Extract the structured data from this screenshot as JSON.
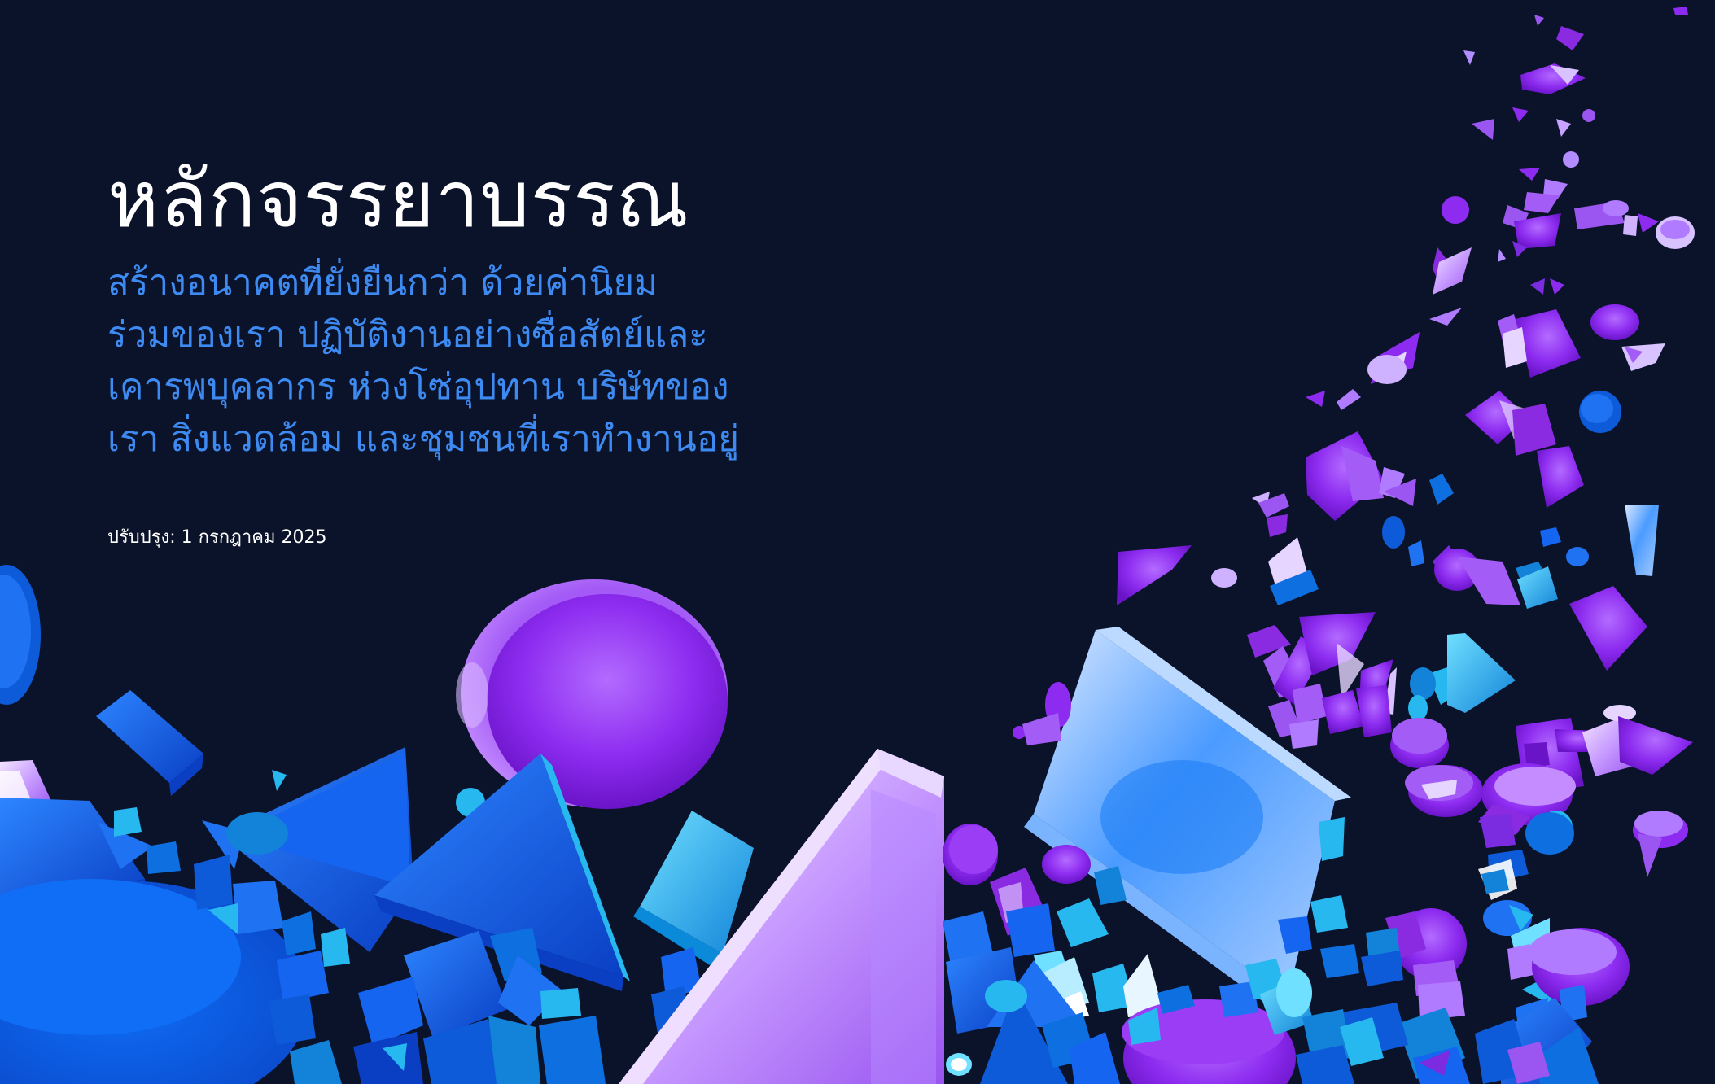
{
  "document": {
    "title": "หลักจรรยาบรรณ",
    "subtitle_lines": [
      "สร้างอนาคตที่ยั่งยืนกว่า ด้วยค่านิยม",
      "ร่วมของเรา ปฏิบัติงานอย่างซื่อสัตย์และ",
      "เคารพบุคลากร ห่วงโซ่อุปทาน บริษัทของ",
      "เรา สิ่งแวดล้อม และชุมชนที่เราทำงานอยู่"
    ],
    "updated": "ปรับปรุง: 1 กรกฎาคม 2025"
  },
  "colors": {
    "background": "#0b132b",
    "title": "#ffffff",
    "subtitle": "#3d8bf2",
    "purple": "#8a2be2",
    "lavender": "#c9a2ff",
    "blue": "#1565f0",
    "cyan": "#28b8f0"
  }
}
